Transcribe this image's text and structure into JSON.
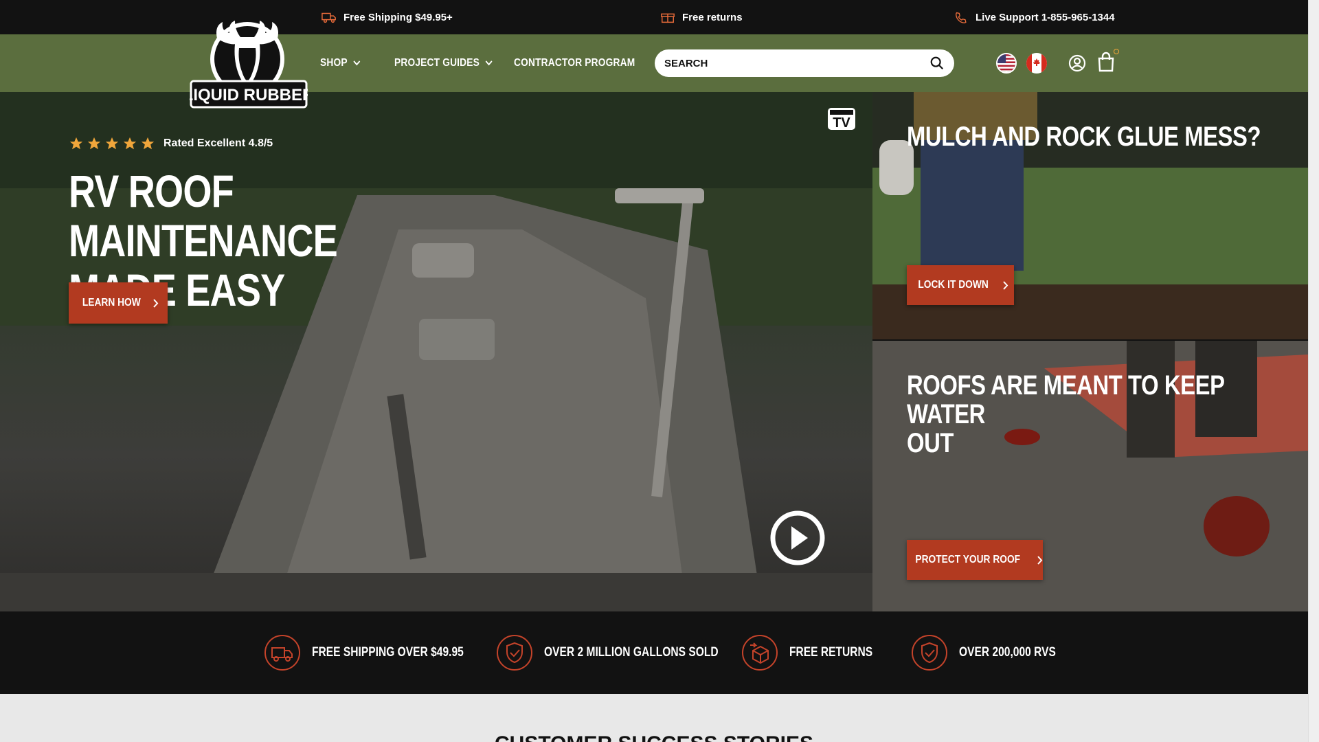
{
  "topbar": {
    "shipping": "Free Shipping $49.95+",
    "returns": "Free returns",
    "support": "Live Support 1-855-965-1344"
  },
  "brand": {
    "logo_text": "LIQUID RUBBER",
    "color_green": "#5b6e3e",
    "color_red": "#b23a20",
    "color_orange": "#f0a63b"
  },
  "nav": {
    "shop": "SHOP",
    "guides": "PROJECT GUIDES",
    "contractor": "CONTRACTOR PROGRAM",
    "search_placeholder": "SEARCH"
  },
  "hero": {
    "rating": "Rated Excellent 4.8/5",
    "stars": 5,
    "title_line1": "RV ROOF MAINTENANCE",
    "title_line2": "MADE EASY",
    "cta": "LEARN HOW",
    "tv_badge": "TV"
  },
  "panels": [
    {
      "title": "MULCH AND ROCK GLUE MESS?",
      "cta": "LOCK IT DOWN"
    },
    {
      "title_line1": "ROOFS ARE MEANT TO KEEP WATER",
      "title_line2": "OUT",
      "cta": "PROTECT YOUR ROOF"
    }
  ],
  "usp": [
    {
      "label": "FREE SHIPPING OVER $49.95",
      "icon": "truck-icon"
    },
    {
      "label": "OVER 2 MILLION GALLONS SOLD",
      "icon": "shield-check-icon"
    },
    {
      "label": "FREE RETURNS",
      "icon": "return-box-icon"
    },
    {
      "label": "OVER 200,000 RVS",
      "icon": "shield-check-icon"
    }
  ],
  "section": {
    "title": "CUSTOMER SUCCESS STORIES"
  }
}
